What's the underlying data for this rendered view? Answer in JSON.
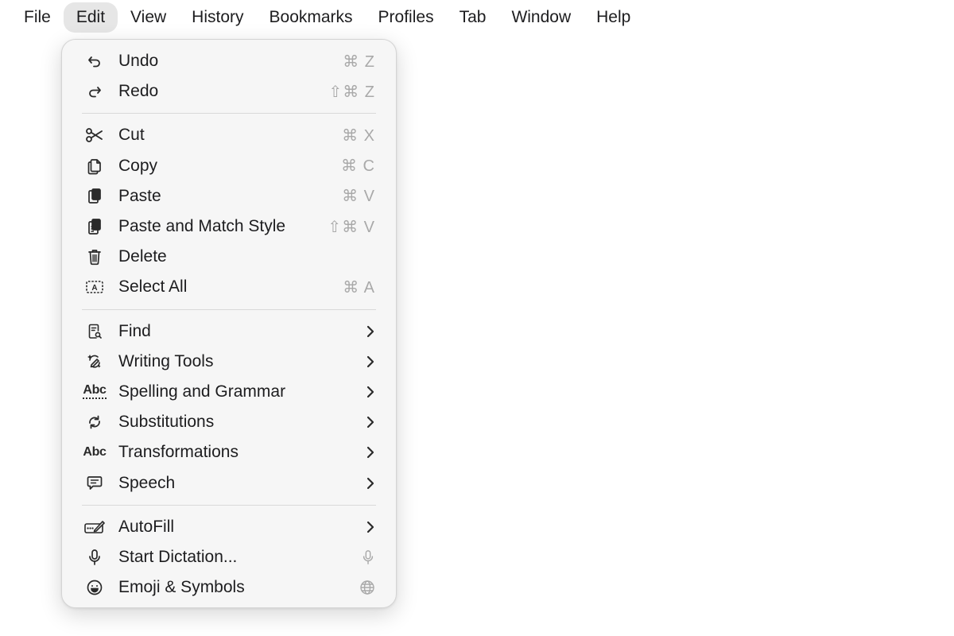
{
  "menubar": {
    "items": [
      {
        "label": "File"
      },
      {
        "label": "Edit",
        "active": true
      },
      {
        "label": "View"
      },
      {
        "label": "History"
      },
      {
        "label": "Bookmarks"
      },
      {
        "label": "Profiles"
      },
      {
        "label": "Tab"
      },
      {
        "label": "Window"
      },
      {
        "label": "Help"
      }
    ]
  },
  "edit_menu": {
    "undo": {
      "label": "Undo",
      "shortcut": "⌘ Z",
      "icon": "undo-icon"
    },
    "redo": {
      "label": "Redo",
      "shortcut": "⇧⌘ Z",
      "icon": "redo-icon"
    },
    "cut": {
      "label": "Cut",
      "shortcut": "⌘ X",
      "icon": "scissors-icon"
    },
    "copy": {
      "label": "Copy",
      "shortcut": "⌘ C",
      "icon": "copy-icon"
    },
    "paste": {
      "label": "Paste",
      "shortcut": "⌘ V",
      "icon": "paste-icon"
    },
    "paste_match": {
      "label": "Paste and Match Style",
      "shortcut": "⇧⌘ V",
      "icon": "paste-match-icon"
    },
    "delete": {
      "label": "Delete",
      "icon": "trash-icon"
    },
    "select_all": {
      "label": "Select All",
      "shortcut": "⌘ A",
      "icon": "select-all-icon"
    },
    "find": {
      "label": "Find",
      "icon": "find-icon"
    },
    "writing_tools": {
      "label": "Writing Tools",
      "icon": "writing-tools-icon"
    },
    "spelling": {
      "label": "Spelling and Grammar",
      "icon_text": "Abc"
    },
    "substitutions": {
      "label": "Substitutions",
      "icon": "substitutions-icon"
    },
    "transformations": {
      "label": "Transformations",
      "icon_text": "Abc"
    },
    "speech": {
      "label": "Speech",
      "icon": "speech-bubble-icon"
    },
    "autofill": {
      "label": "AutoFill",
      "icon": "autofill-icon"
    },
    "dictation": {
      "label": "Start Dictation...",
      "icon": "microphone-icon"
    },
    "emoji": {
      "label": "Emoji & Symbols",
      "icon": "smiley-icon"
    }
  },
  "colors": {
    "menu_background": "#f6f6f6",
    "active_menubar_highlight": "#e6e6e6",
    "shortcut_text": "#a9a9a9",
    "label_text": "#1d1d1f"
  }
}
